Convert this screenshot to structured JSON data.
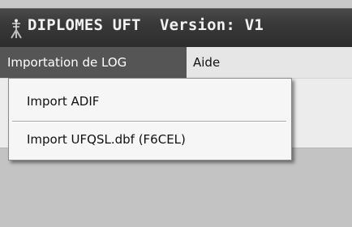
{
  "window": {
    "title": "DIPLOMES UFT  Version: V1"
  },
  "menubar": {
    "items": [
      {
        "label": "Importation de LOG",
        "state": "open"
      },
      {
        "label": "Aide"
      }
    ]
  },
  "dropdown": {
    "items": [
      {
        "label": "Import ADIF"
      },
      {
        "label": "Import UFQSL.dbf (F6CEL)"
      }
    ]
  },
  "icons": {
    "app": "antenna-icon"
  },
  "colors": {
    "titlebar": "#3a3a3a",
    "title_text": "#f2f2f2",
    "menu_active_bg": "#555555",
    "menu_active_text": "#ffffff",
    "menubar_bg": "#e6e6e6",
    "dropdown_bg": "#f6f6f6",
    "client_bg": "#c3c3c3"
  }
}
